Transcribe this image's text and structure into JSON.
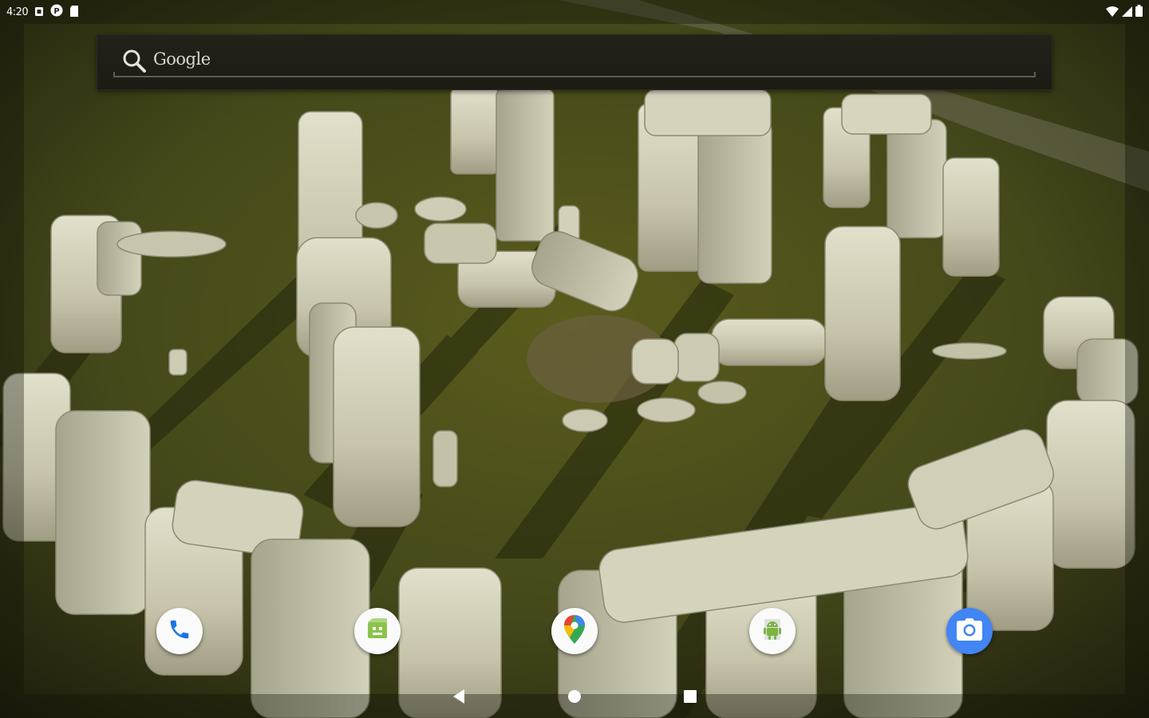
{
  "status_bar": {
    "time": "4:20",
    "left_icons": [
      "sim-card-icon",
      "face-notification-icon",
      "notification-icon",
      "sd-card-icon"
    ],
    "right_icons": [
      "wifi-icon",
      "cellular-signal-icon",
      "battery-icon"
    ]
  },
  "search": {
    "label": "Google"
  },
  "dock": {
    "apps": [
      {
        "icon": "phone-icon"
      },
      {
        "icon": "messaging-icon"
      },
      {
        "icon": "maps-icon"
      },
      {
        "icon": "android-app-icon"
      },
      {
        "icon": "camera-icon"
      }
    ]
  },
  "nav": {
    "buttons": [
      "back-icon",
      "home-icon",
      "recents-icon"
    ]
  },
  "colors": {
    "grass": "#4f5317",
    "stone": "#c9c6ae",
    "accent_blue": "#4285f4",
    "android_green": "#7cb342"
  }
}
